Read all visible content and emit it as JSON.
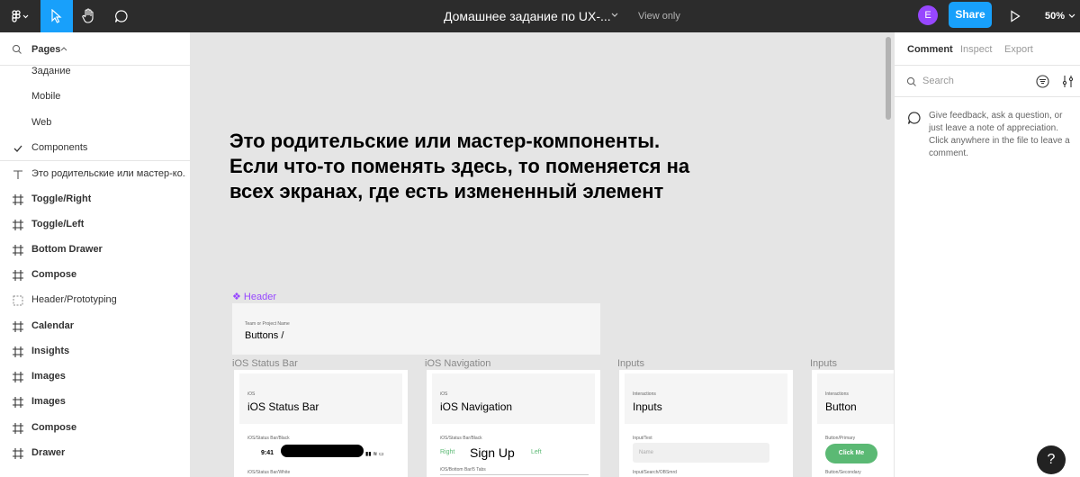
{
  "toolbar": {
    "document_title": "Домашнее задание по UX-...",
    "view_only": "View only",
    "avatar_initial": "E",
    "share_label": "Share",
    "zoom": "50%"
  },
  "pages": {
    "label": "Pages",
    "items": [
      "Задание",
      "Mobile",
      "Web",
      "Components"
    ]
  },
  "layers": [
    {
      "label": "Это родительские или мастер-ко...",
      "icon": "text-icon"
    },
    {
      "label": "Toggle/Right",
      "icon": "frame-icon"
    },
    {
      "label": "Toggle/Left",
      "icon": "frame-icon"
    },
    {
      "label": "Bottom Drawer",
      "icon": "frame-icon"
    },
    {
      "label": "Compose",
      "icon": "frame-icon"
    },
    {
      "label": "Header/Prototyping",
      "icon": "section-icon"
    },
    {
      "label": "Calendar",
      "icon": "frame-icon"
    },
    {
      "label": "Insights",
      "icon": "frame-icon"
    },
    {
      "label": "Images",
      "icon": "frame-icon"
    },
    {
      "label": "Images",
      "icon": "frame-icon"
    },
    {
      "label": "Compose",
      "icon": "frame-icon"
    },
    {
      "label": "Drawer",
      "icon": "frame-icon"
    }
  ],
  "canvas": {
    "heading": "Это родительские или мастер-компоненты. Если что-то поменять здесь, то поменяется на всех экранах, где есть измененный элемент",
    "header_component_label": "Header",
    "header_frame": {
      "caption": "Team or Project Name",
      "title": "Buttons /"
    },
    "frames": [
      {
        "label": "iOS Status Bar",
        "category": "iOS",
        "title": "iOS Status Bar",
        "sub1": "iOS/Status Bar/Black",
        "time": "9:41",
        "sub2": "iOS/Status Bar/White"
      },
      {
        "label": "iOS Navigation",
        "category": "iOS",
        "title": "iOS Navigation",
        "sub1": "iOS/Status Bar/Black",
        "nav_left": "Right",
        "nav_title": "Sign Up",
        "nav_right": "Left",
        "sub2": "iOS/Bottom Bar/5 Tabs"
      },
      {
        "label": "Inputs",
        "category": "Interactions",
        "title": "Inputs",
        "sub1": "Input/Text",
        "placeholder": "Name",
        "sub2": "Input/Search/OBSmrd"
      },
      {
        "label": "Inputs",
        "category": "Interactions",
        "title": "Button",
        "sub1": "Button/Primary",
        "button": "Click Me",
        "sub2": "Button/Secondary"
      }
    ]
  },
  "right_panel": {
    "tabs": [
      "Comment",
      "Inspect",
      "Export"
    ],
    "search_placeholder": "Search",
    "feedback": "Give feedback, ask a question, or just leave a note of appreciation. Click anywhere in the file to leave a comment."
  },
  "help_label": "?",
  "colors": {
    "accent": "#18a0fb",
    "toolbar": "#2c2c2c",
    "avatar": "#9747ff",
    "component": "#9747ff",
    "button_green": "#5bb974"
  }
}
